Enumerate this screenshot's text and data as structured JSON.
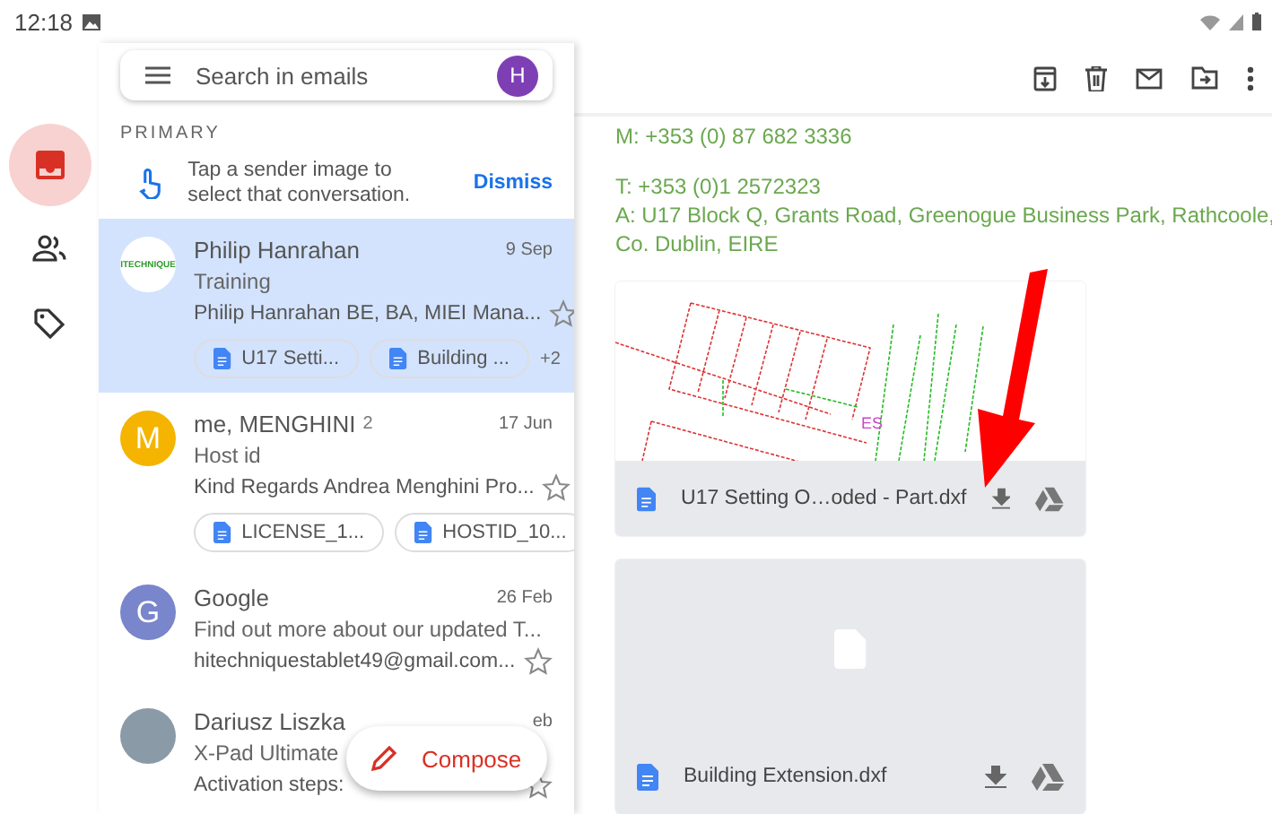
{
  "status_bar": {
    "time": "12:18"
  },
  "rail": [
    {
      "kind": "inbox",
      "selected": true
    },
    {
      "kind": "people",
      "selected": false
    },
    {
      "kind": "label",
      "selected": false
    }
  ],
  "search": {
    "placeholder": "Search in emails",
    "avatar": "H"
  },
  "section": "PRIMARY",
  "tip": {
    "text": "Tap a sender image to select that conversation.",
    "action": "Dismiss"
  },
  "emails": [
    {
      "sender": "Philip Hanrahan",
      "date": "9 Sep",
      "subject": "Training",
      "snippet": "Philip Hanrahan BE, BA, MIEI Mana...",
      "selected": true,
      "starred": false,
      "avatar": {
        "kind": "logo",
        "text": "ITECHNIQUE"
      },
      "attachments": [
        "U17 Setti...",
        "Building ..."
      ],
      "more": "+2"
    },
    {
      "sender": "me, MENGHINI",
      "count": "2",
      "date": "17 Jun",
      "subject": "Host id",
      "snippet": "Kind Regards Andrea Menghini Pro...",
      "selected": false,
      "starred": false,
      "avatar": {
        "kind": "letter",
        "text": "M",
        "color": "#f4b400"
      },
      "attachments": [
        "LICENSE_1...",
        "HOSTID_10..."
      ]
    },
    {
      "sender": "Google",
      "date": "26 Feb",
      "subject": "Find out more about our updated T...",
      "snippet": "hitechniquestablet49@gmail.com...",
      "selected": false,
      "starred": false,
      "avatar": {
        "kind": "letter",
        "text": "G",
        "color": "#7986cb"
      }
    },
    {
      "sender": "Dariusz Liszka",
      "date": "eb",
      "subject": "X-Pad Ultimate",
      "snippet": "Activation steps:",
      "selected": false,
      "starred": false,
      "avatar": {
        "kind": "photo"
      }
    }
  ],
  "compose": "Compose",
  "message": {
    "lines": [
      "M: +353 (0) 87 682 3336",
      "T: +353 (0)1 2572323",
      "A: U17 Block Q, Grants Road, Greenogue Business Park, Rathcoole, Co. Dublin, EIRE"
    ],
    "attachments": [
      {
        "name": "U17 Setting O…oded - Part.dxf",
        "kind": "drawing",
        "label": "ES"
      },
      {
        "name": "Building Extension.dxf",
        "kind": "blank"
      }
    ]
  }
}
